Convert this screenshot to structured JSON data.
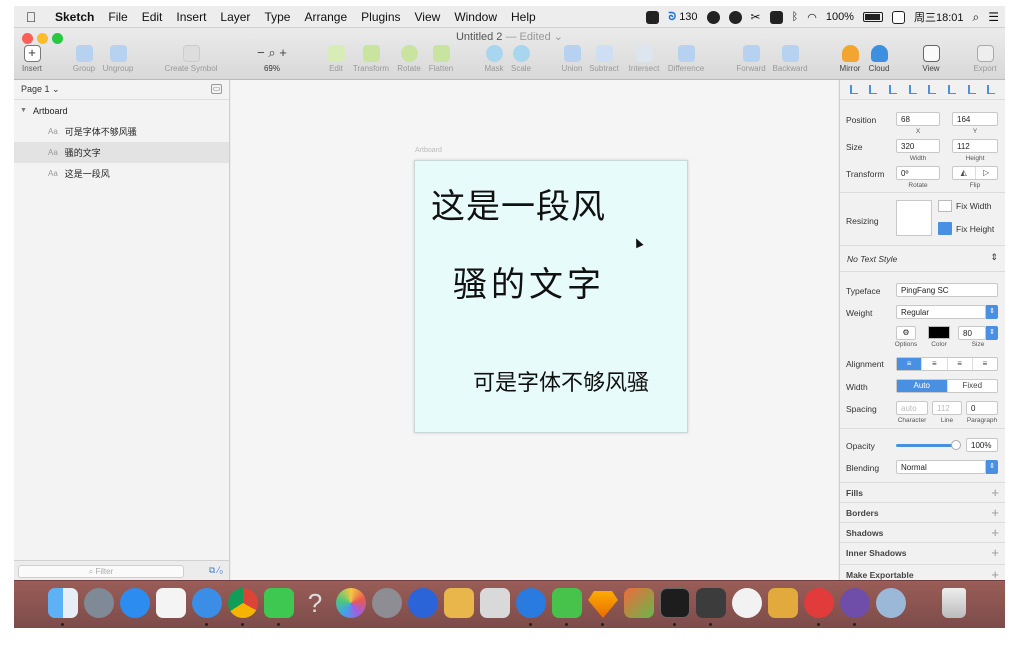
{
  "menubar": {
    "app_name": "Sketch",
    "items": [
      "File",
      "Edit",
      "Insert",
      "Layer",
      "Type",
      "Arrange",
      "Plugins",
      "View",
      "Window",
      "Help"
    ],
    "status": {
      "badge_count": "130",
      "battery": "100%",
      "clock": "周三18:01"
    }
  },
  "window": {
    "title": "Untitled 2",
    "edited": "— Edited ⌄"
  },
  "toolbar": {
    "insert": "Insert",
    "group": "Group",
    "ungroup": "Ungroup",
    "create_symbol": "Create Symbol",
    "zoom": "69%",
    "zoom_minus": "−",
    "zoom_plus": "+",
    "edit": "Edit",
    "transform": "Transform",
    "rotate": "Rotate",
    "flatten": "Flatten",
    "mask": "Mask",
    "scale": "Scale",
    "union": "Union",
    "subtract": "Subtract",
    "intersect": "Intersect",
    "difference": "Difference",
    "forward": "Forward",
    "backward": "Backward",
    "mirror": "Mirror",
    "cloud": "Cloud",
    "view": "View",
    "export": "Export"
  },
  "sidebar": {
    "page": "Page 1 ⌄",
    "artboard": "Artboard",
    "layers": [
      "可是字体不够风骚",
      "骚的文字",
      "这是一段风"
    ],
    "filter_placeholder": "Filter"
  },
  "canvas": {
    "artboard_label": "Artboard",
    "texts": [
      "这是一段风",
      "骚的文字",
      "可是字体不够风骚"
    ]
  },
  "inspector": {
    "position_label": "Position",
    "x": "68",
    "y": "164",
    "x_label": "X",
    "y_label": "Y",
    "size_label": "Size",
    "width": "320",
    "height": "112",
    "width_label": "Width",
    "height_label": "Height",
    "transform_label": "Transform",
    "rotate": "0º",
    "rotate_label": "Rotate",
    "flip_label": "Flip",
    "resizing_label": "Resizing",
    "fix_width": "Fix Width",
    "fix_height": "Fix Height",
    "text_style": "No Text Style",
    "typeface_label": "Typeface",
    "typeface": "PingFang SC",
    "weight_label": "Weight",
    "weight": "Regular",
    "options_label": "Options",
    "color_label": "Color",
    "font_size": "80",
    "size_label2": "Size",
    "alignment_label": "Alignment",
    "width_mode_label": "Width",
    "width_auto": "Auto",
    "width_fixed": "Fixed",
    "spacing_label": "Spacing",
    "char_spacing": "auto",
    "line_spacing": "112",
    "para_spacing": "0",
    "character_label": "Character",
    "line_label": "Line",
    "paragraph_label": "Paragraph",
    "opacity_label": "Opacity",
    "opacity": "100%",
    "blending_label": "Blending",
    "blending": "Normal",
    "sections": [
      "Fills",
      "Borders",
      "Shadows",
      "Inner Shadows",
      "Make Exportable"
    ]
  },
  "colors": {
    "accent": "#4a90e2",
    "artboard_bg": "#e8fbfb",
    "dock": "#8c5652"
  }
}
